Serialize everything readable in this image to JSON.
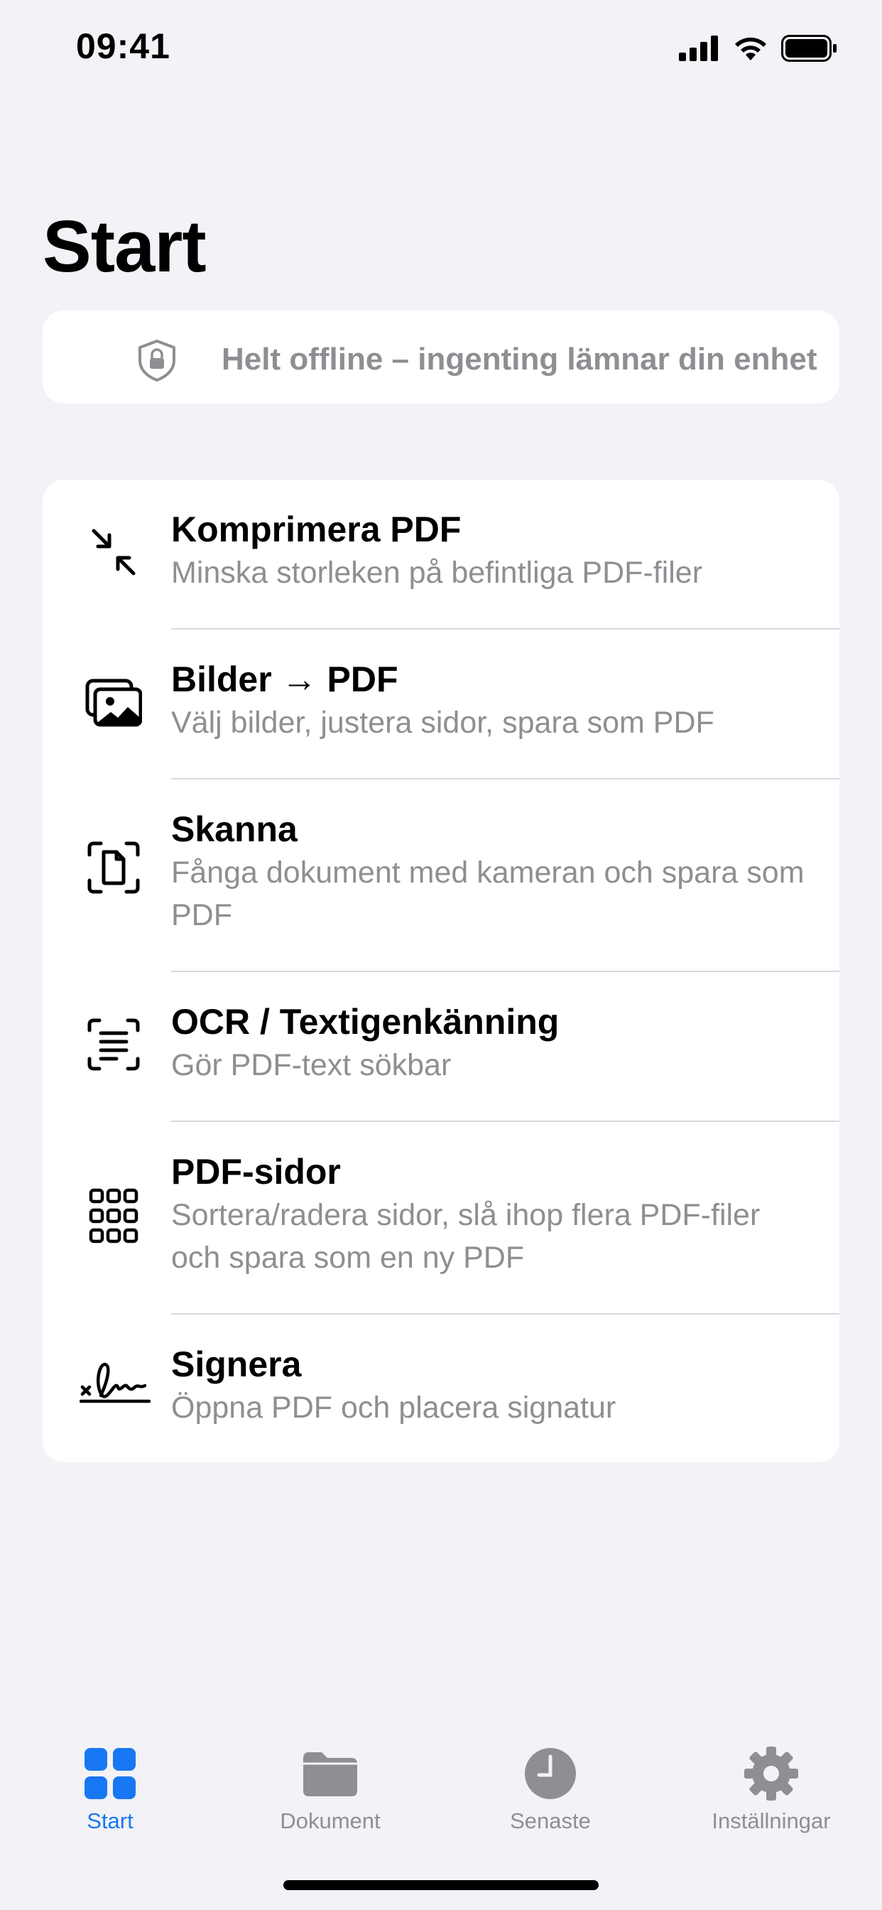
{
  "status_bar": {
    "time": "09:41"
  },
  "page": {
    "title": "Start"
  },
  "banner": {
    "text": "Helt offline – ingenting lämnar din enhet",
    "icon": "shield-lock-icon"
  },
  "tools": [
    {
      "icon": "compress-arrows-icon",
      "title": "Komprimera PDF",
      "description": "Minska storleken på befintliga PDF-filer"
    },
    {
      "icon": "images-icon",
      "title": "Bilder → PDF",
      "description": "Välj bilder, justera sidor, spara som PDF"
    },
    {
      "icon": "document-scanner-icon",
      "title": "Skanna",
      "description": "Fånga dokument med kameran och spara som PDF"
    },
    {
      "icon": "text-recognition-icon",
      "title": "OCR / Textigenkänning",
      "description": "Gör PDF-text sökbar"
    },
    {
      "icon": "grid-pages-icon",
      "title": "PDF-sidor",
      "description": "Sortera/radera sidor, slå ihop flera PDF-filer och spara som en ny PDF"
    },
    {
      "icon": "signature-icon",
      "title": "Signera",
      "description": "Öppna PDF och placera signatur"
    }
  ],
  "tab_bar": {
    "tabs": [
      {
        "label": "Start",
        "icon": "grid-icon",
        "active": true
      },
      {
        "label": "Dokument",
        "icon": "folder-icon",
        "active": false
      },
      {
        "label": "Senaste",
        "icon": "clock-icon",
        "active": false
      },
      {
        "label": "Inställningar",
        "icon": "gear-icon",
        "active": false
      }
    ]
  },
  "colors": {
    "accent": "#1877f2",
    "background": "#f2f2f7",
    "secondary_text": "#8e8e93"
  }
}
